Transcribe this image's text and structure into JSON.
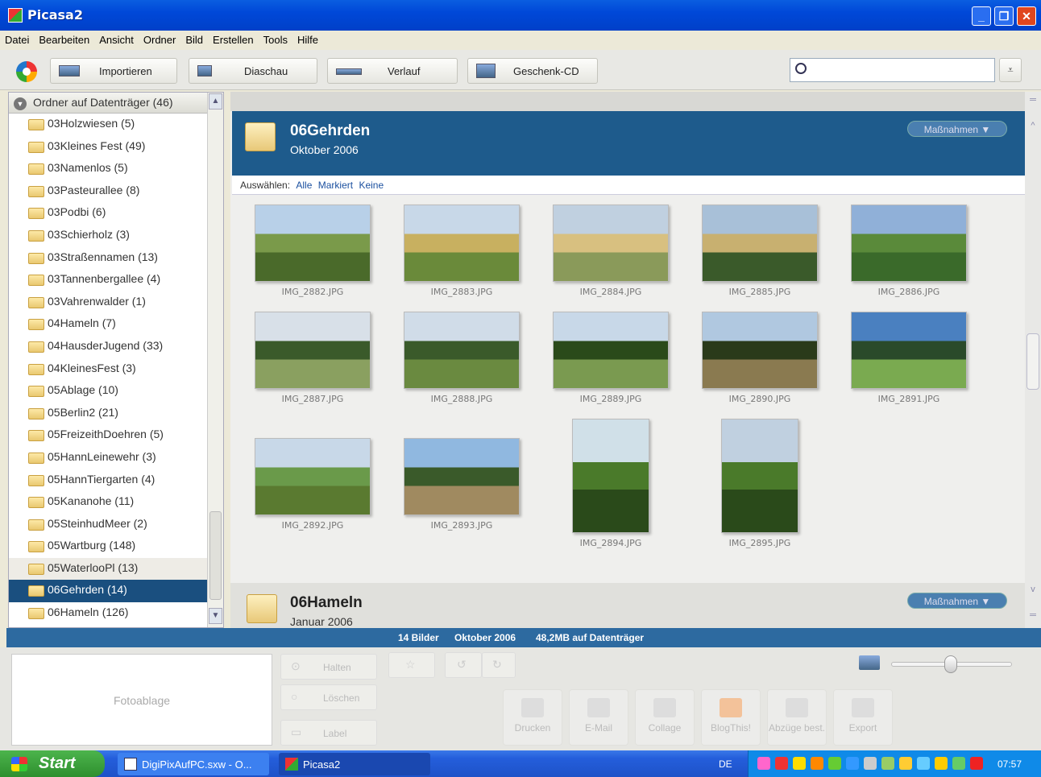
{
  "window": {
    "title": "Picasa2"
  },
  "menu": [
    "Datei",
    "Bearbeiten",
    "Ansicht",
    "Ordner",
    "Bild",
    "Erstellen",
    "Tools",
    "Hilfe"
  ],
  "toolbar": {
    "import_label": "Importieren",
    "slideshow_label": "Diaschau",
    "timeline_label": "Verlauf",
    "giftcd_label": "Geschenk-CD",
    "search_value": ""
  },
  "sidebar": {
    "header": "Ordner auf Datenträger (46)",
    "folders": [
      "03Holzwiesen (5)",
      "03Kleines Fest (49)",
      "03Namenlos (5)",
      "03Pasteurallee (8)",
      "03Podbi (6)",
      "03Schierholz (3)",
      "03Straßennamen (13)",
      "03Tannenbergallee (4)",
      "03Vahrenwalder (1)",
      "04Hameln (7)",
      "04HausderJugend (33)",
      "04KleinesFest (3)",
      "05Ablage (10)",
      "05Berlin2 (21)",
      "05FreizeithDoehren (5)",
      "05HannLeinewehr (3)",
      "05HannTiergarten (4)",
      "05Kananohe (11)",
      "05SteinhudMeer (2)",
      "05Wartburg (148)",
      "05WaterlooPl (13)",
      "06Gehrden (14)",
      "06Hameln (126)"
    ]
  },
  "album": {
    "name": "06Gehrden",
    "date": "Oktober 2006",
    "actions_label": "Maßnahmen",
    "select_label": "Auswählen:",
    "select_all": "Alle",
    "select_marked": "Markiert",
    "select_none": "Keine",
    "photos": [
      "IMG_2882.JPG",
      "IMG_2883.JPG",
      "IMG_2884.JPG",
      "IMG_2885.JPG",
      "IMG_2886.JPG",
      "IMG_2887.JPG",
      "IMG_2888.JPG",
      "IMG_2889.JPG",
      "IMG_2890.JPG",
      "IMG_2891.JPG",
      "IMG_2892.JPG",
      "IMG_2893.JPG",
      "IMG_2894.JPG",
      "IMG_2895.JPG"
    ]
  },
  "album2": {
    "name": "06Hameln",
    "date": "Januar 2006",
    "actions_label": "Maßnahmen"
  },
  "status": {
    "count": "14 Bilder",
    "date": "Oktober 2006",
    "size": "48,2MB auf Datenträger"
  },
  "tray": {
    "fotoablage": "Fotoablage",
    "hold": "Halten",
    "delete": "Löschen",
    "label": "Label",
    "actions": [
      "Drucken",
      "E-Mail",
      "Collage",
      "BlogThis!",
      "Abzüge best.",
      "Export"
    ]
  },
  "taskbar": {
    "start": "Start",
    "items": [
      "DigiPixAufPC.sxw - O...",
      "Picasa2"
    ],
    "lang": "DE",
    "clock": "07:57"
  },
  "colors": {
    "titlebar": "#0048d8",
    "album_header": "#1e5b8c",
    "statusbar": "#2d6aa0",
    "selected": "#1a4f7f"
  }
}
